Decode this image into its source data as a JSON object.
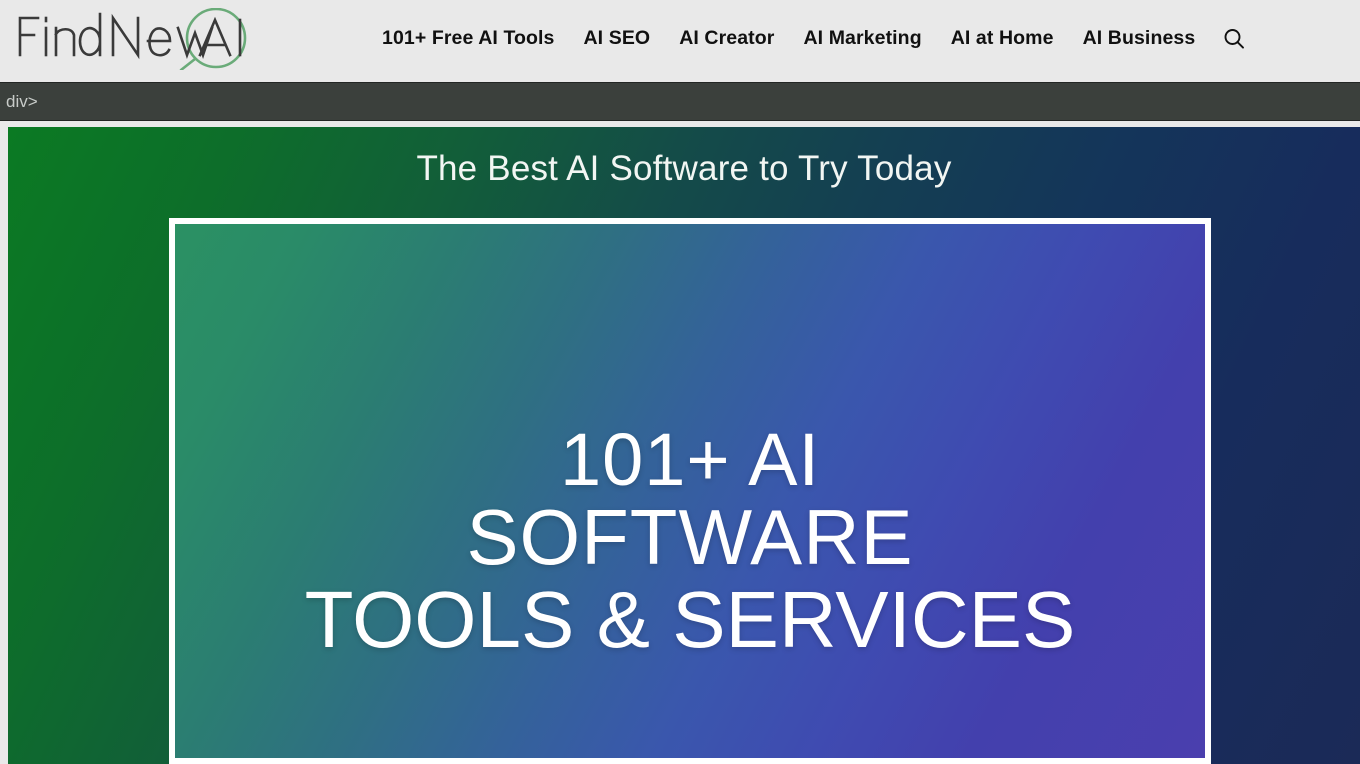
{
  "header": {
    "logo": {
      "name": "FindNewAI",
      "text_part_1": "FindNew",
      "text_part_2": "AI",
      "circle_color": "#6aab79",
      "text_color": "#3a3a3a"
    },
    "nav": {
      "items": [
        {
          "label": "101+ Free AI Tools",
          "name": "nav-item-free-ai-tools"
        },
        {
          "label": "AI SEO",
          "name": "nav-item-ai-seo"
        },
        {
          "label": "AI Creator",
          "name": "nav-item-ai-creator"
        },
        {
          "label": "AI Marketing",
          "name": "nav-item-ai-marketing"
        },
        {
          "label": "AI at Home",
          "name": "nav-item-ai-at-home"
        },
        {
          "label": "AI Business",
          "name": "nav-item-ai-business"
        }
      ]
    },
    "search": {
      "icon": "search-icon",
      "label": "Search"
    },
    "background_color": "#e9e9e9",
    "text_color": "#111111"
  },
  "inspector": {
    "path_text": "div>",
    "background_color": "#3b403c",
    "text_color": "#c8ccc9"
  },
  "hero": {
    "title": "The Best AI Software to Try Today",
    "title_color": "#f2f6f3",
    "gradient_start": "#0b7a23",
    "gradient_end": "#1b2a57",
    "promo": {
      "border_color": "#ffffff",
      "line_1": "101+ AI",
      "line_2": "SOFTWARE",
      "line_3": "TOOLS & SERVICES",
      "gradient_start": "#2b9163",
      "gradient_end": "#4a3fae",
      "text_color": "#ffffff"
    }
  }
}
